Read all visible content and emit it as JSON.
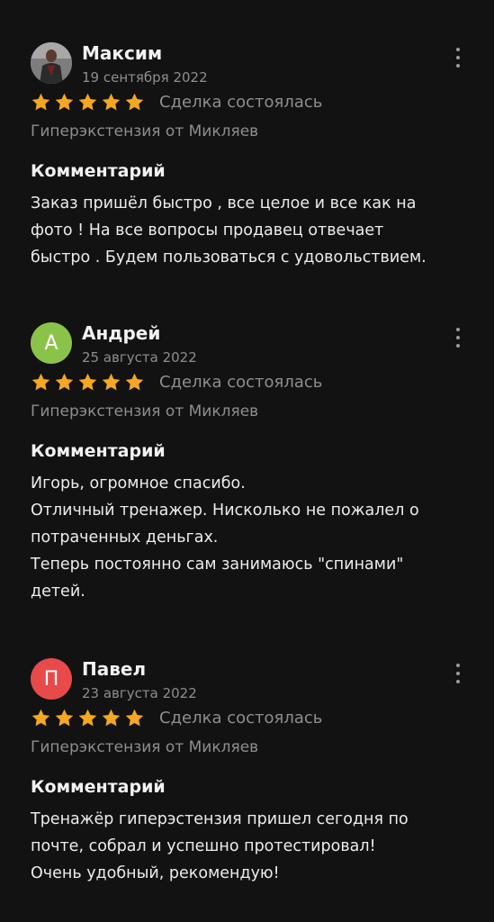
{
  "colors": {
    "background": "#121212",
    "star": "#f5a623",
    "avatar_andrey": "#8bc34a",
    "avatar_pavel": "#e84a4a",
    "muted_text": "#8e8e8e"
  },
  "icons": {
    "star": "star-icon",
    "more": "more-vertical-icon"
  },
  "reviews": [
    {
      "name": "Максим",
      "date": "19 сентября 2022",
      "rating": 5,
      "avatar_type": "photo",
      "avatar_letter": "",
      "status": "Сделка состоялась",
      "product": "Гиперэкстензия от Микляев",
      "comment_heading": "Комментарий",
      "comment_lines": [
        "Заказ пришёл быстро , все целое и все как на",
        "фото ! На все вопросы продавец отвечает",
        "быстро . Будем пользоваться с удовольствием."
      ]
    },
    {
      "name": "Андрей",
      "date": "25 августа 2022",
      "rating": 5,
      "avatar_type": "letter",
      "avatar_letter": "А",
      "status": "Сделка состоялась",
      "product": "Гиперэкстензия от Микляев",
      "comment_heading": "Комментарий",
      "comment_lines": [
        "Игорь, огромное спасибо.",
        "Отличный тренажер. Нисколько не пожалел о",
        "потраченных деньгах.",
        "Теперь постоянно сам занимаюсь \"спинами\"",
        "детей."
      ]
    },
    {
      "name": "Павел",
      "date": "23 августа 2022",
      "rating": 5,
      "avatar_type": "letter",
      "avatar_letter": "П",
      "status": "Сделка состоялась",
      "product": "Гиперэкстензия от Микляев",
      "comment_heading": "Комментарий",
      "comment_lines": [
        "Тренажёр гиперэстензия пришел сегодня по",
        "почте, собрал и успешно протестировал!",
        "Очень удобный, рекомендую!"
      ]
    }
  ]
}
